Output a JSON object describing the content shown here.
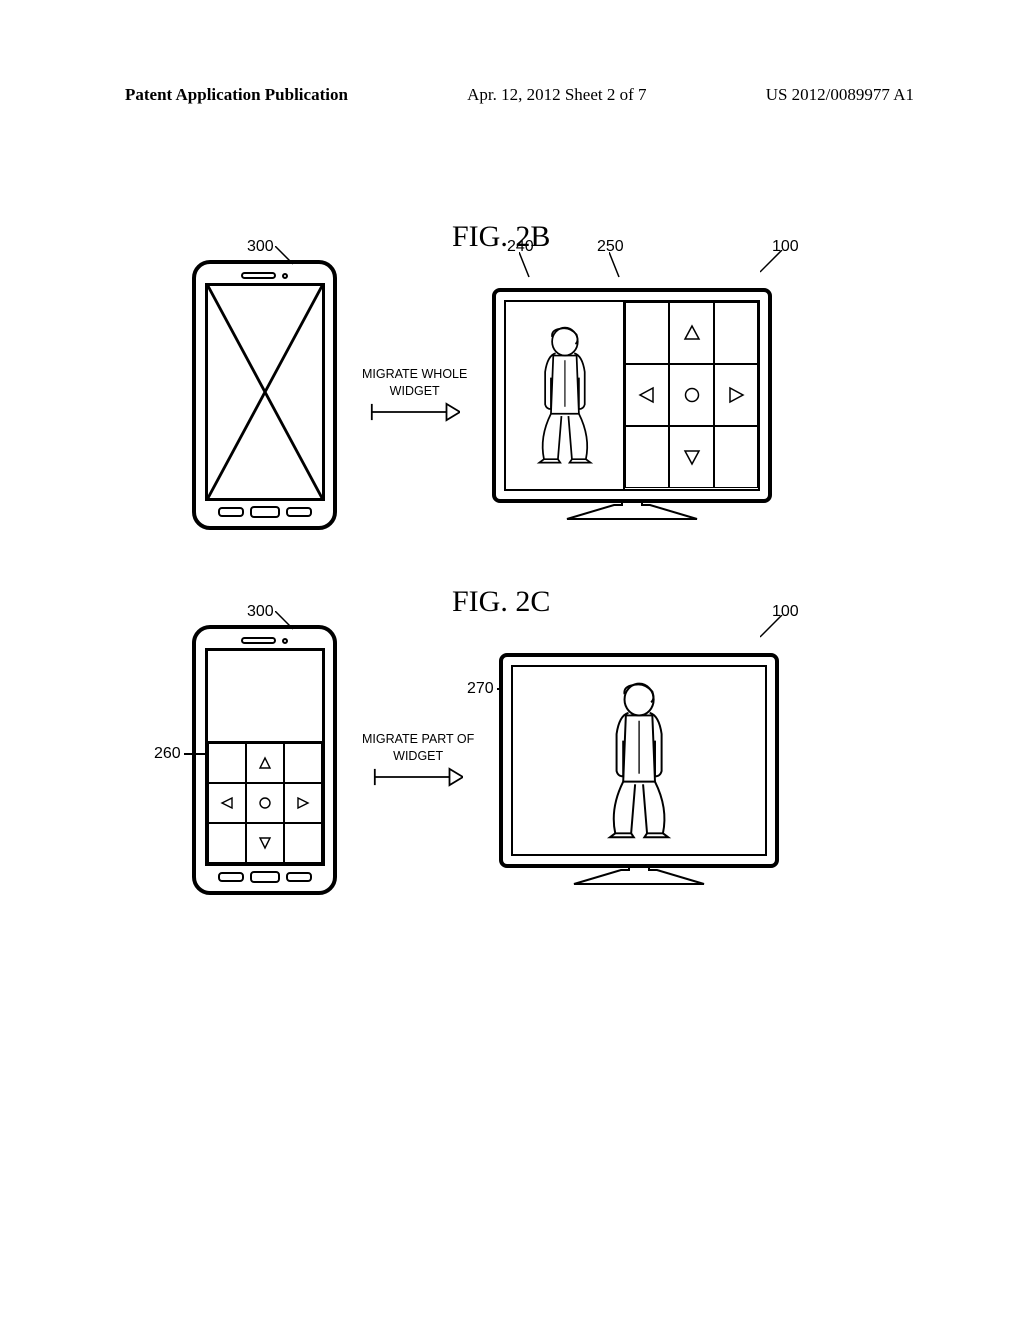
{
  "header": {
    "left": "Patent Application Publication",
    "center": "Apr. 12, 2012  Sheet 2 of 7",
    "right": "US 2012/0089977 A1"
  },
  "figures": {
    "b": {
      "label": "FIG. 2B",
      "migrate_label_l1": "MIGRATE WHOLE",
      "migrate_label_l2": "WIDGET",
      "refs": {
        "phone": "300",
        "tv_left": "240",
        "tv_right": "250",
        "tv": "100"
      }
    },
    "c": {
      "label": "FIG. 2C",
      "migrate_label_l1": "MIGRATE PART OF",
      "migrate_label_l2": "WIDGET",
      "refs": {
        "phone": "300",
        "phone_grid": "260",
        "tv": "100",
        "tv_left": "270"
      }
    }
  },
  "icons": {
    "up": "up-triangle",
    "down": "down-triangle",
    "left": "left-triangle",
    "right": "right-triangle",
    "center": "circle"
  }
}
